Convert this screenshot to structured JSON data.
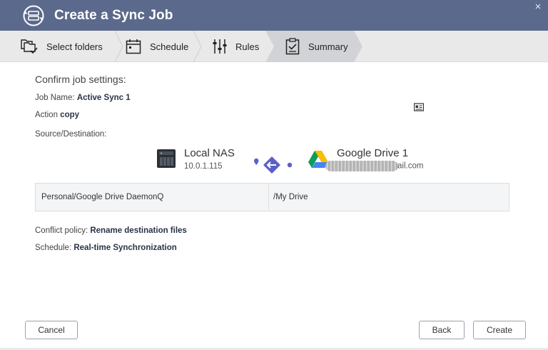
{
  "window": {
    "title": "Create a Sync Job",
    "close_glyph": "×"
  },
  "steps": [
    {
      "label": "Select folders",
      "icon": "folders-check-icon",
      "active": false
    },
    {
      "label": "Schedule",
      "icon": "calendar-icon",
      "active": false
    },
    {
      "label": "Rules",
      "icon": "sliders-icon",
      "active": false
    },
    {
      "label": "Summary",
      "icon": "clipboard-check-icon",
      "active": true
    }
  ],
  "summary": {
    "heading": "Confirm job settings:",
    "job_name_label": "Job Name:",
    "job_name_value": "Active Sync 1",
    "action_label": "Action",
    "action_value": "copy",
    "source_destination_label": "Source/Destination:",
    "source": {
      "name": "Local NAS",
      "ip": "10.0.1.115",
      "icon": "nas-icon"
    },
    "destination": {
      "name": "Google Drive 1",
      "email_visible": "ail.com",
      "icon": "google-drive-icon"
    },
    "paths": {
      "source_path": "Personal/Google Drive DaemonQ",
      "destination_path": "/My Drive"
    },
    "conflict_policy_label": "Conflict policy:",
    "conflict_policy_value": "Rename destination files",
    "schedule_label": "Schedule:",
    "schedule_value": "Real-time Synchronization"
  },
  "buttons": {
    "cancel": "Cancel",
    "back": "Back",
    "create": "Create"
  },
  "colors": {
    "titlebar": "#5b6a8c",
    "steps_bg": "#e9e9ea",
    "active_step_bg": "#d2d3d6",
    "link_accent": "#5b5fc7",
    "value_text": "#2a3347"
  }
}
